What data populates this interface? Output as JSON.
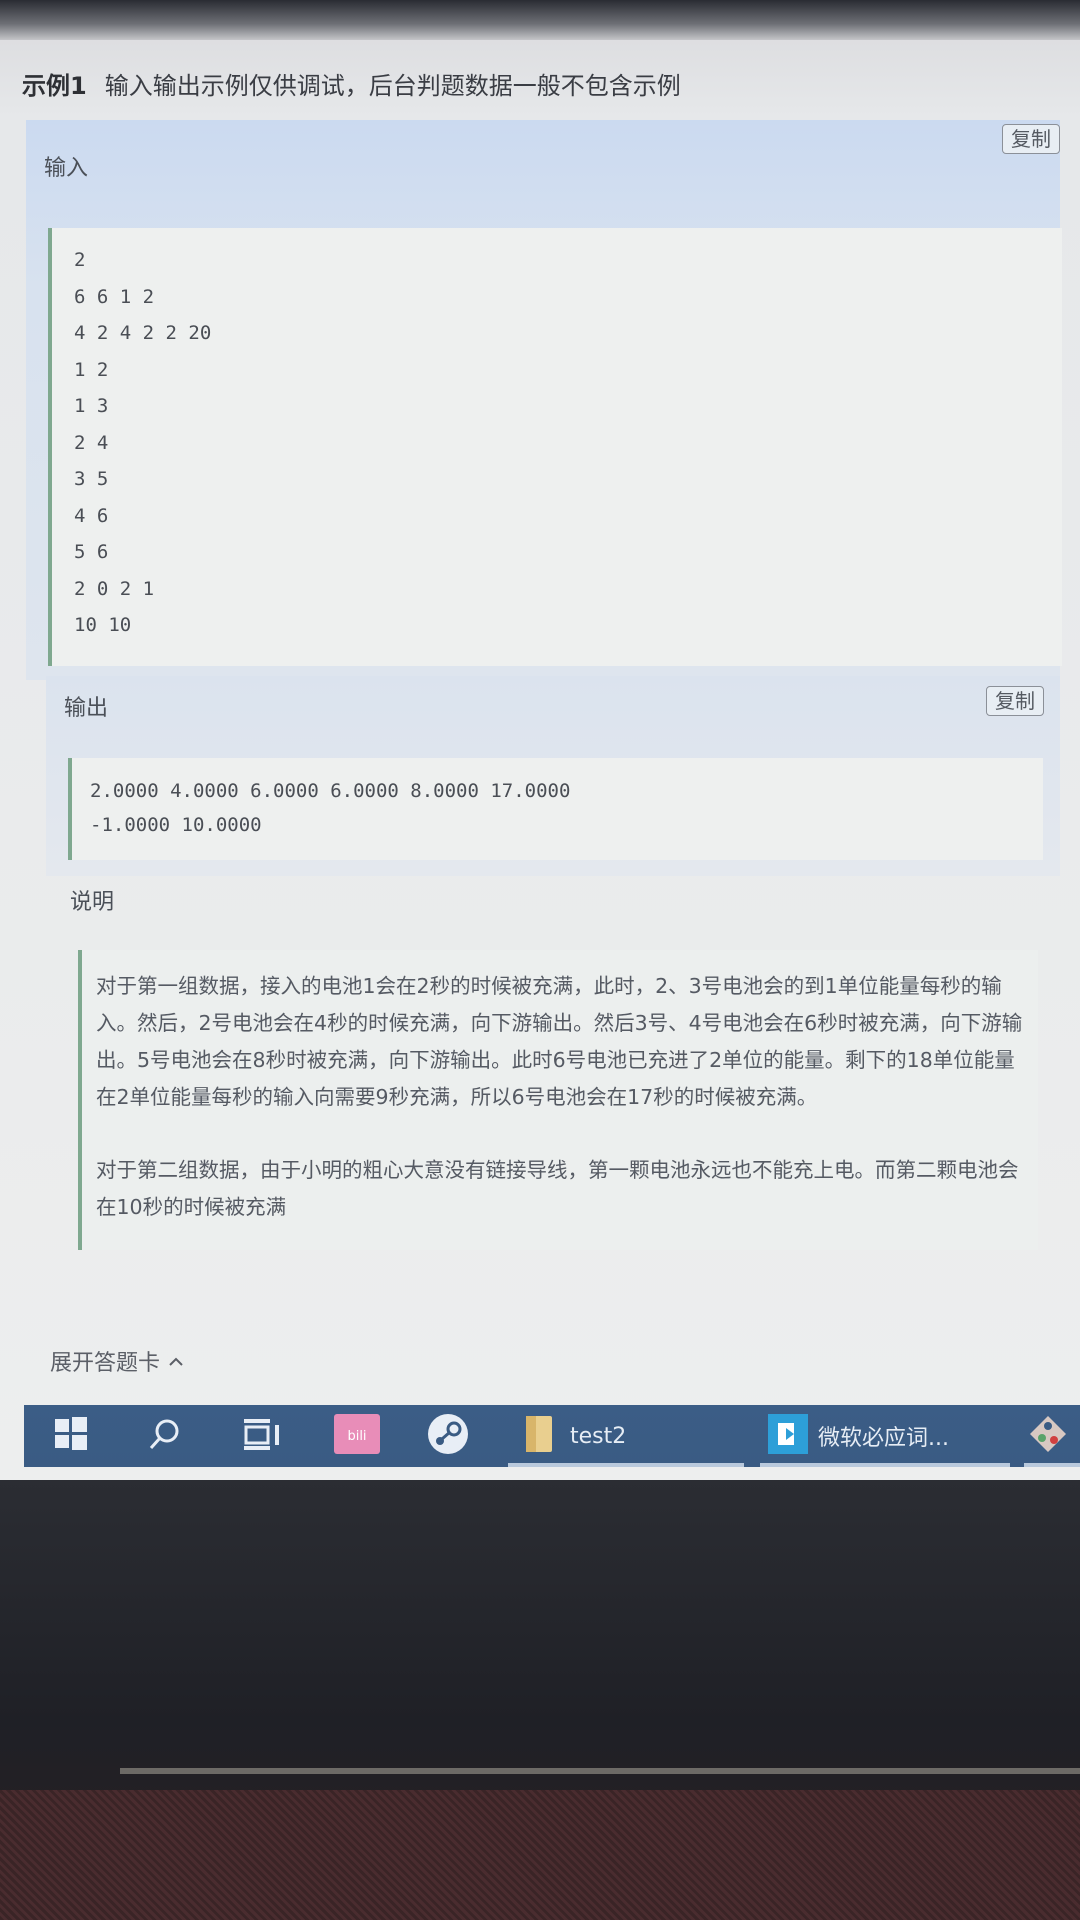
{
  "example": {
    "tag": "示例1",
    "note": "输入输出示例仅供调试，后台判题数据一般不包含示例"
  },
  "input": {
    "title": "输入",
    "copy_label": "复制",
    "lines": [
      "2",
      "6 6 1 2",
      "4 2 4 2 2 20",
      "1 2",
      "1 3",
      "2 4",
      "3 5",
      "4 6",
      "5 6",
      "2 0 2 1",
      "10 10"
    ]
  },
  "output": {
    "title": "输出",
    "copy_label": "复制",
    "lines": [
      "2.0000 4.0000 6.0000 6.0000 8.0000 17.0000",
      "-1.0000 10.0000"
    ]
  },
  "explanation": {
    "title": "说明",
    "paragraphs": [
      "对于第一组数据，接入的电池1会在2秒的时候被充满，此时，2、3号电池会的到1单位能量每秒的输入。然后，2号电池会在4秒的时候充满，向下游输出。然后3号、4号电池会在6秒时被充满，向下游输出。5号电池会在8秒时被充满，向下游输出。此时6号电池已充进了2单位的能量。剩下的18单位能量在2单位能量每秒的输入向需要9秒充满，所以6号电池会在17秒的时候被充满。",
      "对于第二组数据，由于小明的粗心大意没有链接导线，第一颗电池永远也不能充上电。而第二颗电池会在10秒的时候被充满"
    ]
  },
  "answer_sheet": {
    "label": "展开答题卡",
    "icon": "chevron-up-icon"
  },
  "taskbar": {
    "items": [
      {
        "name": "start",
        "icon": "windows-icon"
      },
      {
        "name": "search",
        "icon": "search-icon"
      },
      {
        "name": "task-view",
        "icon": "task-view-icon"
      },
      {
        "name": "bilibili",
        "icon": "bilibili-icon"
      },
      {
        "name": "steam",
        "icon": "steam-icon"
      },
      {
        "name": "folder",
        "icon": "folder-icon",
        "label": "test2"
      },
      {
        "name": "dictionary",
        "icon": "dictionary-icon",
        "label": "微软必应词..."
      },
      {
        "name": "git",
        "icon": "git-icon"
      }
    ]
  },
  "colors": {
    "accent_border": "#7fa88f",
    "taskbar": "#3b5d86"
  }
}
